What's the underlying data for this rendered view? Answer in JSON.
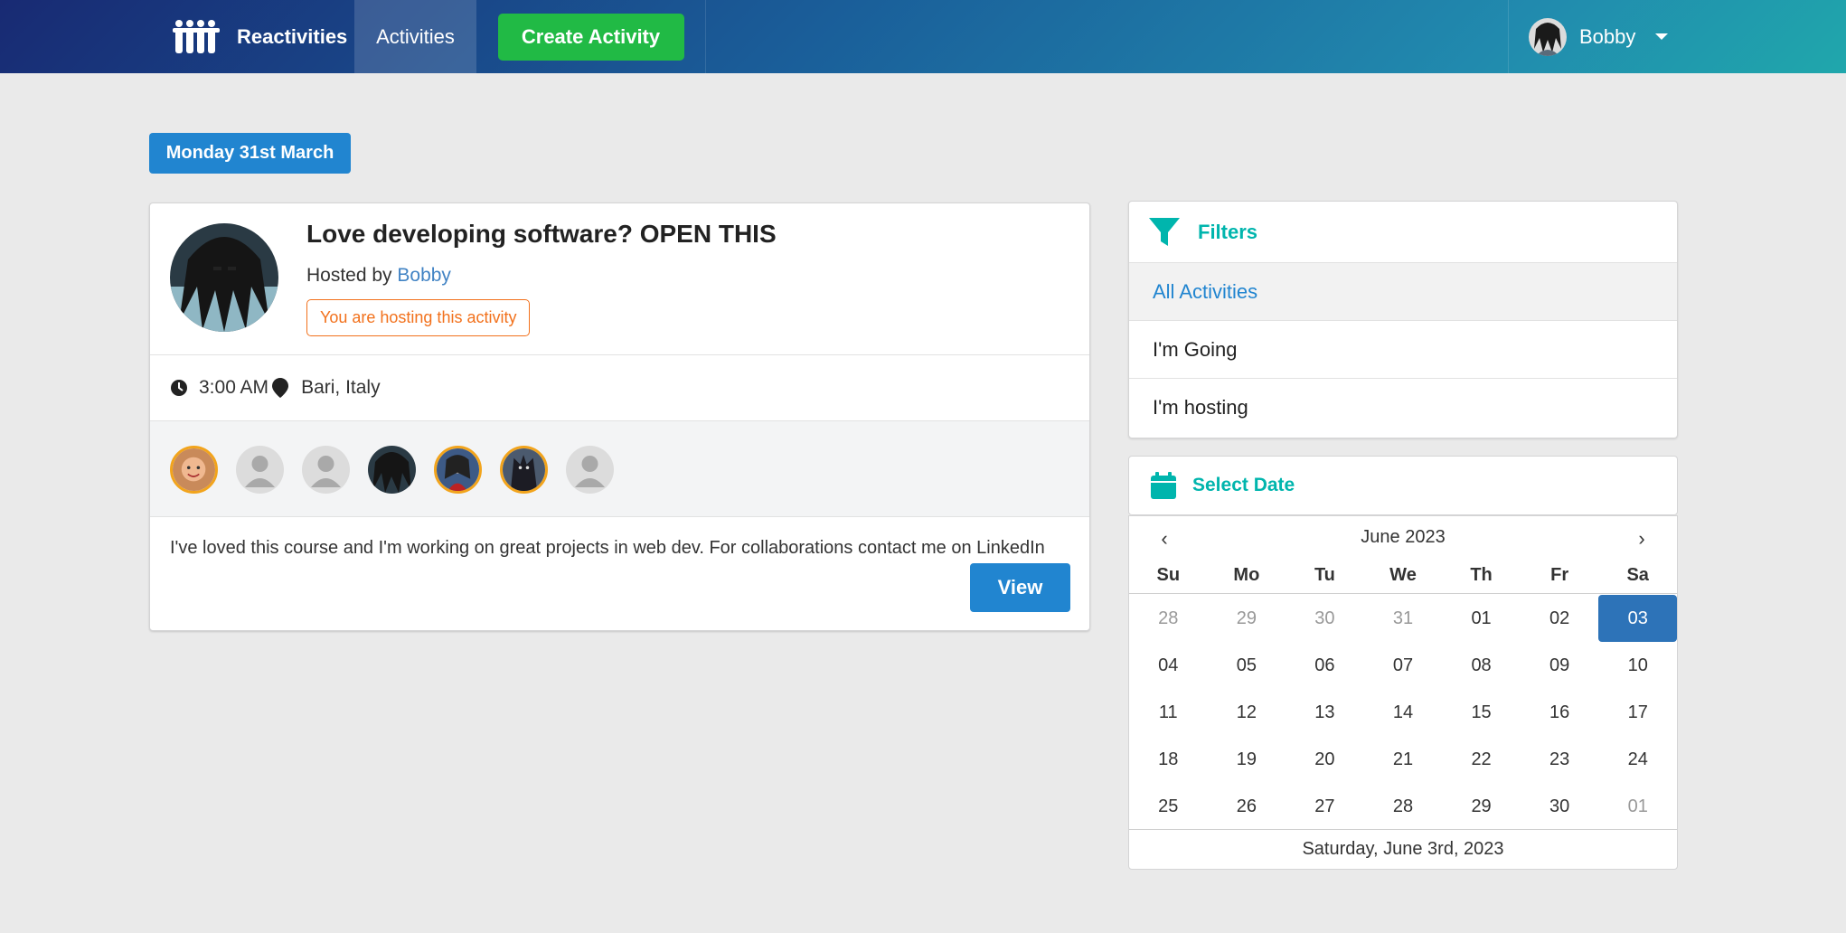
{
  "nav": {
    "brand": "Reactivities",
    "activities": "Activities",
    "create": "Create Activity",
    "user": "Bobby"
  },
  "group_date": "Monday 31st March",
  "activity": {
    "title": "Love developing software? OPEN THIS",
    "hosted_by_prefix": "Hosted by ",
    "host": "Bobby",
    "badge": "You are hosting this activity",
    "time": "3:00 AM",
    "venue": "Bari, Italy",
    "description": "I've loved this course and I'm working on great projects in web dev. For collaborations contact me on LinkedIn",
    "view": "View"
  },
  "filters": {
    "title": "Filters",
    "items": [
      "All Activities",
      "I'm Going",
      "I'm hosting"
    ]
  },
  "date_select": {
    "title": "Select Date",
    "month": "June 2023",
    "weekdays": [
      "Su",
      "Mo",
      "Tu",
      "We",
      "Th",
      "Fr",
      "Sa"
    ],
    "days": [
      "28",
      "29",
      "30",
      "31",
      "01",
      "02",
      "03",
      "04",
      "05",
      "06",
      "07",
      "08",
      "09",
      "10",
      "11",
      "12",
      "13",
      "14",
      "15",
      "16",
      "17",
      "18",
      "19",
      "20",
      "21",
      "22",
      "23",
      "24",
      "25",
      "26",
      "27",
      "28",
      "29",
      "30",
      "01"
    ],
    "selected_label": "Saturday, June 3rd, 2023"
  },
  "colors": {
    "primary": "#2185d0",
    "create": "#21ba45",
    "teal": "#00b5ad",
    "orange": "#f2711c",
    "selected_day": "#2d73b8"
  }
}
